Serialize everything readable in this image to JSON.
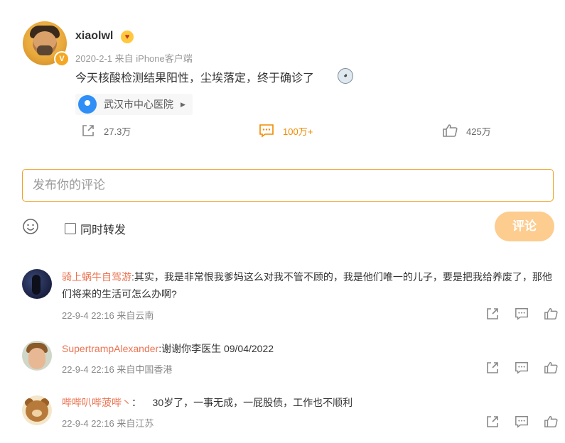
{
  "post": {
    "username": "xiaolwl",
    "meta": "2020-2-1  来自 iPhone客户端",
    "text": "今天核酸检测结果阳性，尘埃落定，终于确诊了",
    "location": "武汉市中心医院"
  },
  "actions": {
    "forward_count": "27.3万",
    "comment_count": "100万+",
    "like_count": "425万"
  },
  "composer": {
    "placeholder": "发布你的评论",
    "sync_label": "同时转发",
    "submit_label": "评论"
  },
  "comments": [
    {
      "user": "骑上蜗牛自驾游",
      "text": ":其实，我是非常恨我爹妈这么对我不管不顾的，我是他们唯一的儿子，要是把我给养废了，那他们将来的生活可怎么办啊?",
      "meta": "22-9-4 22:16 来自云南"
    },
    {
      "user": "SupertrampAlexander",
      "text": ":谢谢你李医生 09/04/2022",
      "meta": "22-9-4 22:16 来自中国香港"
    },
    {
      "user": "哔哔叭哔菠哔丶",
      "text": "：    30岁了，一事无成，一屁股债，工作也不顺利",
      "meta": "22-9-4 22:16 来自江苏"
    }
  ],
  "colors": {
    "accent": "#f08a00",
    "username_link": "#eb7350",
    "submit_disabled": "#fdcc8f",
    "location_pin": "#2f8ff7"
  }
}
